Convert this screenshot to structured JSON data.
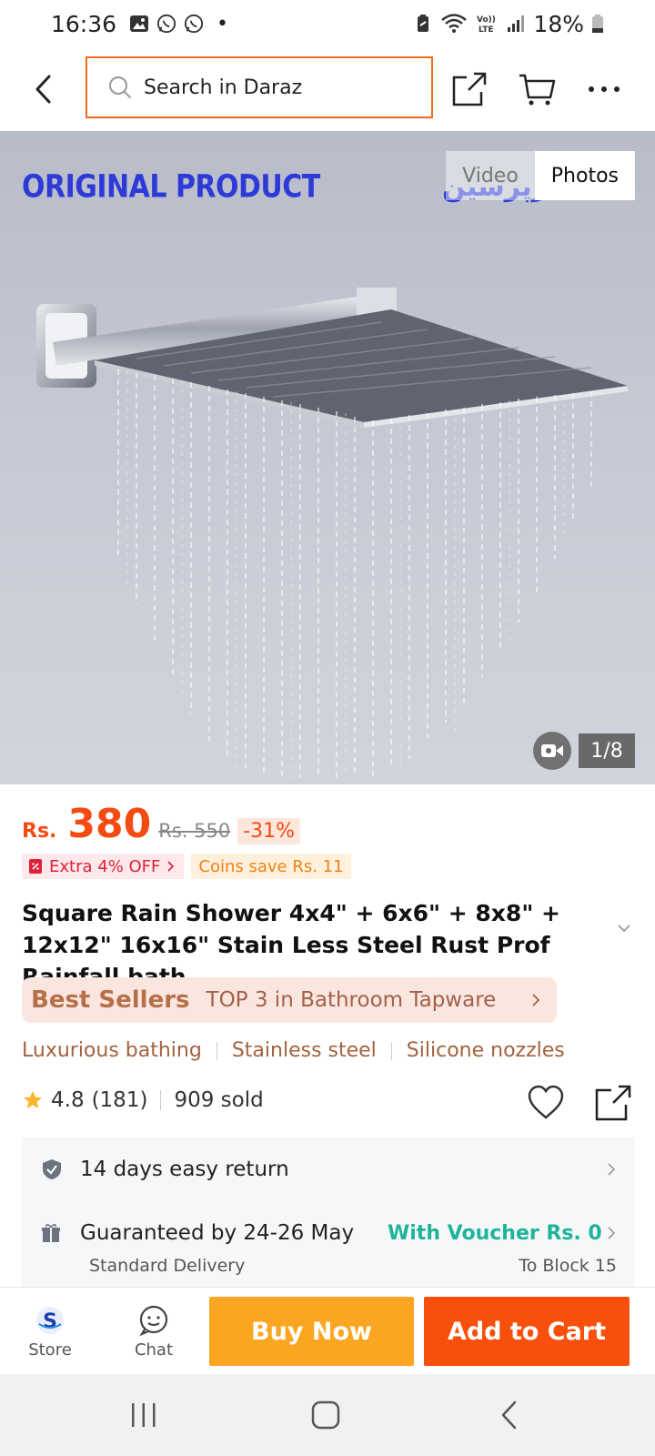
{
  "status_bar": {
    "time": "16:36",
    "dot": "•",
    "battery": "18%",
    "icons": [
      "gallery-icon",
      "whatsapp-icon",
      "whatsapp-icon",
      "battery-saver-icon",
      "wifi-icon",
      "volte-icon",
      "signal-icon",
      "battery-icon"
    ]
  },
  "header": {
    "search_placeholder": "Search in Daraz",
    "icons": [
      "back-icon",
      "search-icon",
      "share-icon",
      "cart-icon",
      "more-icon"
    ]
  },
  "gallery": {
    "overlay_label": "ORIGINAL PRODUCT",
    "watermark": "سرپرسین",
    "tabs": [
      "Video",
      "Photos"
    ],
    "active_tab": "Photos",
    "counter": "1/8"
  },
  "price": {
    "currency": "Rs.",
    "current": "380",
    "original": "Rs. 550",
    "discount": "-31%"
  },
  "promos": {
    "extra_off": "Extra 4% OFF",
    "coins": "Coins save Rs. 11"
  },
  "product": {
    "title": "Square Rain Shower 4x4\" + 6x6\" + 8x8\" + 12x12\" 16x16\" Stain Less Steel Rust Prof Rainfall bath ..."
  },
  "best_sellers": {
    "badge": "Best Sellers",
    "text": "TOP 3 in Bathroom Tapware"
  },
  "features": [
    "Luxurious bathing",
    "Stainless steel",
    "Silicone nozzles"
  ],
  "rating": {
    "score": "4.8",
    "count": "(181)",
    "sold": "909 sold"
  },
  "services": {
    "return": "14 days easy return",
    "delivery": "Guaranteed by 24-26 May",
    "voucher": "With Voucher Rs. 0",
    "delivery_type": "Standard Delivery",
    "destination": "To Block 15"
  },
  "bottom_bar": {
    "store": "Store",
    "chat": "Chat",
    "buy_now": "Buy Now",
    "add_to_cart": "Add to Cart"
  },
  "colors": {
    "accent": "#f54a12",
    "buy_now": "#fba620",
    "add_to_cart": "#f8500c",
    "voucher": "#1eb49a",
    "search_border": "#f26a1b"
  }
}
